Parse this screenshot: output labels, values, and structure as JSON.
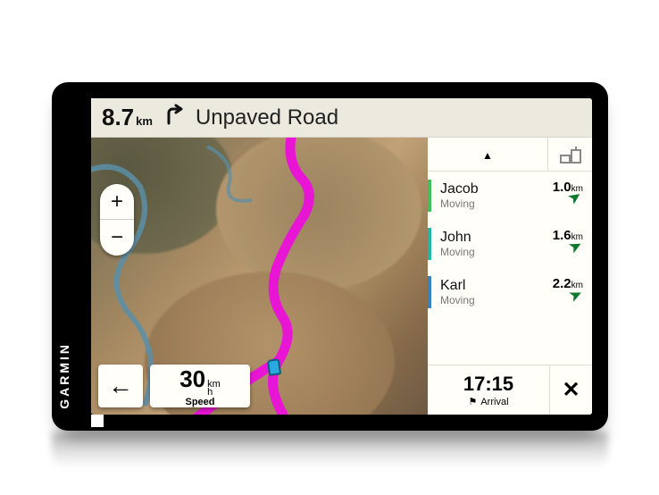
{
  "brand": "GARMIN",
  "nav": {
    "distance_value": "8.7",
    "distance_unit": "km",
    "turn_icon": "turn-right-icon",
    "street": "Unpaved Road"
  },
  "speed": {
    "value": "30",
    "unit_top": "km",
    "unit_bottom": "h",
    "label": "Speed"
  },
  "eta": {
    "time": "17:15",
    "flag_glyph": "⚑",
    "label": "Arrival"
  },
  "riders": [
    {
      "name": "Jacob",
      "status": "Moving",
      "distance": "1.0",
      "unit": "km",
      "color": "#3fbf5a",
      "arrow_deg": 35
    },
    {
      "name": "John",
      "status": "Moving",
      "distance": "1.6",
      "unit": "km",
      "color": "#1fb8a8",
      "arrow_deg": 28
    },
    {
      "name": "Karl",
      "status": "Moving",
      "distance": "2.2",
      "unit": "km",
      "color": "#3881c6",
      "arrow_deg": 25
    }
  ],
  "zoom": {
    "in": "+",
    "out": "−"
  },
  "icons": {
    "back": "←",
    "close": "✕",
    "up": "▲"
  }
}
